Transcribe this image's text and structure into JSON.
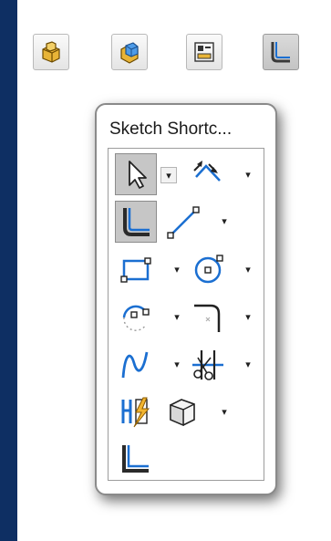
{
  "toolbar": {
    "buttons": [
      {
        "icon": "extruded-boss-icon"
      },
      {
        "icon": "features-icon"
      },
      {
        "icon": "properties-icon"
      },
      {
        "icon": "sketch-icon",
        "active": true
      }
    ]
  },
  "popup": {
    "title": "Sketch Shortc...",
    "tools": [
      {
        "icon": "select-arrow-icon",
        "pressed": true,
        "has_dropdown": true
      },
      {
        "icon": "smart-dimension-icon",
        "has_dropdown": true
      },
      {
        "icon": "sketch-icon",
        "pressed": true
      },
      {
        "icon": "line-icon",
        "has_dropdown": true
      },
      {
        "icon": "rectangle-icon",
        "has_dropdown": true
      },
      {
        "icon": "circle-icon",
        "has_dropdown": true
      },
      {
        "icon": "arc-icon",
        "has_dropdown": true
      },
      {
        "icon": "fillet-icon",
        "has_dropdown": true
      },
      {
        "icon": "spline-icon",
        "has_dropdown": true
      },
      {
        "icon": "trim-entities-icon",
        "has_dropdown": true
      },
      {
        "icon": "quick-snaps-icon"
      },
      {
        "icon": "view-orientation-icon",
        "has_dropdown": true
      },
      {
        "icon": "exit-sketch-icon"
      }
    ]
  },
  "colors": {
    "desktop": "#0e2f63",
    "accent_blue": "#1b6fd1",
    "feature_gold": "#e8b437"
  }
}
